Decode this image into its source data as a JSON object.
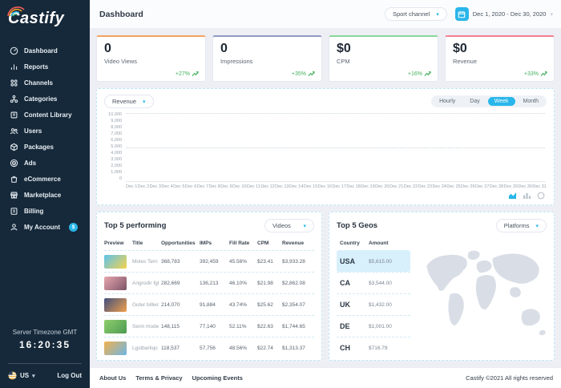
{
  "sidebar": {
    "logo_text": "Castify",
    "items": [
      {
        "label": "Dashboard"
      },
      {
        "label": "Reports"
      },
      {
        "label": "Channels"
      },
      {
        "label": "Categories"
      },
      {
        "label": "Content Library"
      },
      {
        "label": "Users"
      },
      {
        "label": "Packages"
      },
      {
        "label": "Ads"
      },
      {
        "label": "eCommerce"
      },
      {
        "label": "Marketplace"
      },
      {
        "label": "Billing"
      }
    ],
    "account": {
      "label": "My Account",
      "badge": "$"
    },
    "timezone_label": "Server Timezone GMT",
    "server_time": "16:20:35",
    "locale": "US",
    "logout_label": "Log Out"
  },
  "header": {
    "title": "Dashboard",
    "channel_select": "Sport channel",
    "date_range": "Dec 1, 2020 - Dec 30, 2020"
  },
  "stats": [
    {
      "value": "0",
      "label": "Video Views",
      "delta": "+27%",
      "accent": "#f5a15f"
    },
    {
      "value": "0",
      "label": "Impressions",
      "delta": "+35%",
      "accent": "#8e9ac4"
    },
    {
      "value": "$0",
      "label": "CPM",
      "delta": "+16%",
      "accent": "#8ad79b"
    },
    {
      "value": "$0",
      "label": "Revenue",
      "delta": "+33%",
      "accent": "#f27e93"
    }
  ],
  "chart": {
    "metric_select": "Revenue",
    "range_tabs": [
      "Hourly",
      "Day",
      "Week",
      "Month"
    ],
    "active_tab": "Week"
  },
  "chart_data": {
    "type": "line",
    "title": "Revenue",
    "xlabel": "",
    "ylabel": "",
    "x": [
      "Dec 1",
      "Dec 2",
      "Dec 3",
      "Dec 4",
      "Dec 5",
      "Dec 6",
      "Dec 7",
      "Dec 8",
      "Dec 9",
      "Dec 10",
      "Dec 11",
      "Dec 12",
      "Dec 13",
      "Dec 14",
      "Dec 15",
      "Dec 16",
      "Dec 17",
      "Dec 18",
      "Dec 19",
      "Dec 20",
      "Dec 21",
      "Dec 22",
      "Dec 23",
      "Dec 24",
      "Dec 25",
      "Dec 26",
      "Dec 27",
      "Dec 28",
      "Dec 29",
      "Dec 30",
      "Dec 31"
    ],
    "values": [
      0,
      0,
      0,
      0,
      0,
      0,
      0,
      0,
      0,
      0,
      0,
      0,
      0,
      0,
      0,
      0,
      0,
      0,
      0,
      0,
      0,
      0,
      0,
      0,
      0,
      0,
      0,
      0,
      0,
      0,
      0
    ],
    "ylim": [
      0,
      10000
    ],
    "y_tick_labels": [
      "0",
      "1,000",
      "2,000",
      "3,000",
      "4,000",
      "5,000",
      "6,000",
      "7,000",
      "8,000",
      "9,000",
      "10,000"
    ],
    "grid": "dotted horizontal lines at 0, 5000, 10000",
    "legend": "none"
  },
  "performing": {
    "title": "Top 5 performing",
    "filter_select": "Videos",
    "columns": [
      "Preview",
      "Title",
      "Opportunities",
      "IMPs",
      "Fill Rate",
      "CPM",
      "Revenue"
    ],
    "rows": [
      {
        "title": "Moles Tern digt",
        "opportunities": "368,783",
        "imps": "392,459",
        "fill_rate": "45.56%",
        "cpm": "$23.41",
        "revenue": "$3,933.28",
        "thumb_colors": [
          "#5bc3ee",
          "#f5d24b"
        ]
      },
      {
        "title": "Angrodir fgbuin deig",
        "opportunities": "282,669",
        "imps": "136,213",
        "fill_rate": "46.10%",
        "cpm": "$21.98",
        "revenue": "$2,862.08",
        "thumb_colors": [
          "#e8a7ae",
          "#7c5468"
        ]
      },
      {
        "title": "Guter billwongf",
        "opportunities": "214,070",
        "imps": "91,884",
        "fill_rate": "43.74%",
        "cpm": "$25.62",
        "revenue": "$2,354.07",
        "thumb_colors": [
          "#41507c",
          "#f09f4c"
        ]
      },
      {
        "title": "Senn modern qlhapa",
        "opportunities": "148,115",
        "imps": "77,140",
        "fill_rate": "52.11%",
        "cpm": "$22.63",
        "revenue": "$1,744.65",
        "thumb_colors": [
          "#8fcf6d",
          "#4d9a52"
        ]
      },
      {
        "title": "Lgstbarliqo srgh",
        "opportunities": "118,537",
        "imps": "57,756",
        "fill_rate": "48.56%",
        "cpm": "$22.74",
        "revenue": "$1,313.37",
        "thumb_colors": [
          "#f2b14d",
          "#6cb6e6"
        ]
      }
    ]
  },
  "geos": {
    "title": "Top 5 Geos",
    "filter_select": "Platforms",
    "columns": [
      "Country",
      "Amount"
    ],
    "rows": [
      {
        "country": "USA",
        "amount": "$5,615.00",
        "selected": true
      },
      {
        "country": "CA",
        "amount": "$3,544.00",
        "selected": false
      },
      {
        "country": "UK",
        "amount": "$1,432.00",
        "selected": false
      },
      {
        "country": "DE",
        "amount": "$1,001.00",
        "selected": false
      },
      {
        "country": "CH",
        "amount": "$716.79",
        "selected": false
      }
    ]
  },
  "footer": {
    "links": [
      "About Us",
      "Terms & Privacy",
      "Upcoming Events"
    ],
    "copyright": "Castify ©2021 All rights reserved"
  },
  "colors": {
    "accent_blue": "#29b6ea",
    "positive_green": "#42b05c",
    "sidebar_bg": "#16293a"
  }
}
